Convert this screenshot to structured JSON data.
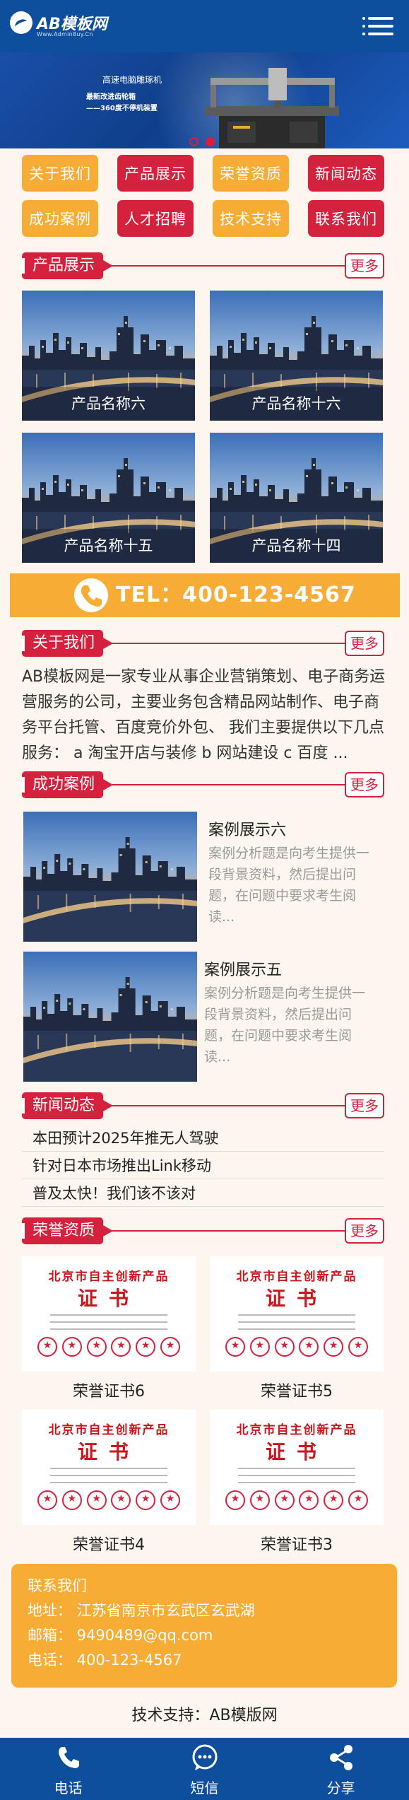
{
  "header": {
    "logo_text": "AB模板网",
    "logo_site": "Www.Admin8uy.Cn"
  },
  "banner": {
    "line1": "高速电脑雕琢机",
    "line2": "最新改进齿轮箱",
    "line3": "——360度不停机装置"
  },
  "nav": [
    {
      "label": "关于我们",
      "color": "#f7ac35"
    },
    {
      "label": "产品展示",
      "color": "#d4213d"
    },
    {
      "label": "荣誉资质",
      "color": "#f7ac35"
    },
    {
      "label": "新闻动态",
      "color": "#d4213d"
    },
    {
      "label": "成功案例",
      "color": "#f7ac35"
    },
    {
      "label": "人才招聘",
      "color": "#d4213d"
    },
    {
      "label": "技术支持",
      "color": "#f7ac35"
    },
    {
      "label": "联系我们",
      "color": "#d4213d"
    }
  ],
  "more_label": "更多",
  "products": {
    "title": "产品展示",
    "items": [
      "产品名称六",
      "产品名称十六",
      "产品名称十五",
      "产品名称十四"
    ]
  },
  "tel": {
    "text": "TEL：400-123-4567"
  },
  "about": {
    "title": "关于我们",
    "text": "AB模板网是一家专业从事企业营销策划、电子商务运营服务的公司，主要业务包含精品网站制作、电子商务平台托管、百度竞价外包、 我们主要提供以下几点服务： a 淘宝开店与装修 b 网站建设 c 百度 ..."
  },
  "cases": {
    "title": "成功案例",
    "items": [
      {
        "title": "案例展示六",
        "desc": "案例分析题是向考生提供一段背景资料，然后提出问题，在问题中要求考生阅读..."
      },
      {
        "title": "案例展示五",
        "desc": "案例分析题是向考生提供一段背景资料，然后提出问题，在问题中要求考生阅读..."
      }
    ]
  },
  "news": {
    "title": "新闻动态",
    "items": [
      "本田预计2025年推无人驾驶",
      "针对日本市场推出Link移动",
      "普及太快！我们该不该对"
    ]
  },
  "honors": {
    "title": "荣誉资质",
    "cert_header": "北京市自主创新产品",
    "cert_word": "证书",
    "items": [
      "荣誉证书6",
      "荣誉证书5",
      "荣誉证书4",
      "荣誉证书3"
    ]
  },
  "contact": {
    "title": "联系我们",
    "address": "地址： 江苏省南京市玄武区玄武湖",
    "email": "邮箱： 9490489@qq.com",
    "phone": "电话： 400-123-4567"
  },
  "support": "技术支持：AB模版网",
  "footer": [
    {
      "label": "电话",
      "icon": "phone-icon"
    },
    {
      "label": "短信",
      "icon": "message-icon"
    },
    {
      "label": "分享",
      "icon": "share-icon"
    }
  ]
}
